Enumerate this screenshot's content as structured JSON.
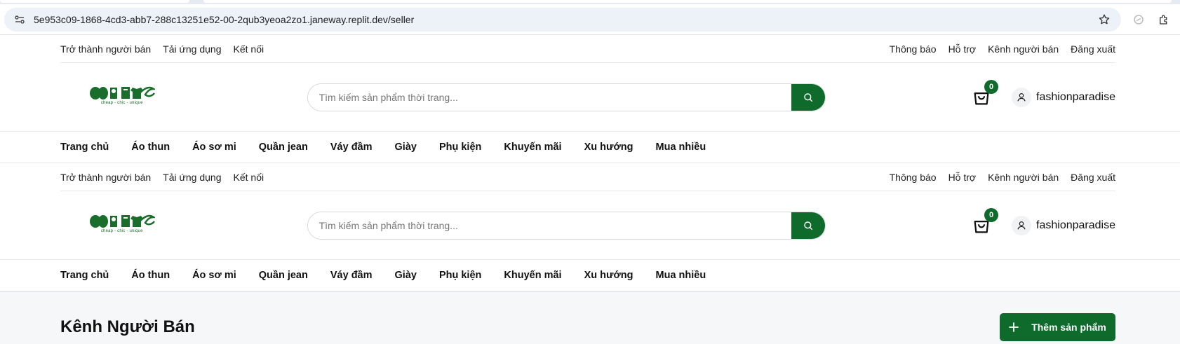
{
  "browser": {
    "url": "5e953c09-1868-4cd3-abb7-288c13251e52-00-2qub3yeoa2zo1.janeway.replit.dev/seller"
  },
  "header": {
    "top_left_links": [
      "Trở thành người bán",
      "Tải ứng dụng",
      "Kết nối"
    ],
    "top_right_links": [
      "Thông báo",
      "Hỗ trợ",
      "Kênh người bán",
      "Đăng xuất"
    ],
    "logo_tagline": "cheap - chic - unique",
    "search_placeholder": "Tìm kiếm sản phẩm thời trang...",
    "cart_count": "0",
    "username": "fashionparadise",
    "nav": [
      "Trang chủ",
      "Áo thun",
      "Áo sơ mi",
      "Quần jean",
      "Váy đầm",
      "Giày",
      "Phụ kiện",
      "Khuyến mãi",
      "Xu hướng",
      "Mua nhiều"
    ]
  },
  "seller": {
    "title": "Kênh Người Bán",
    "add_button": "Thêm sản phẩm"
  },
  "colors": {
    "brand_green": "#0e6b2c",
    "page_bg": "#f6f7f9"
  },
  "icons": [
    "site-info-icon",
    "star-icon",
    "extension-icon",
    "search-icon",
    "cart-icon",
    "user-icon",
    "plus-icon"
  ]
}
